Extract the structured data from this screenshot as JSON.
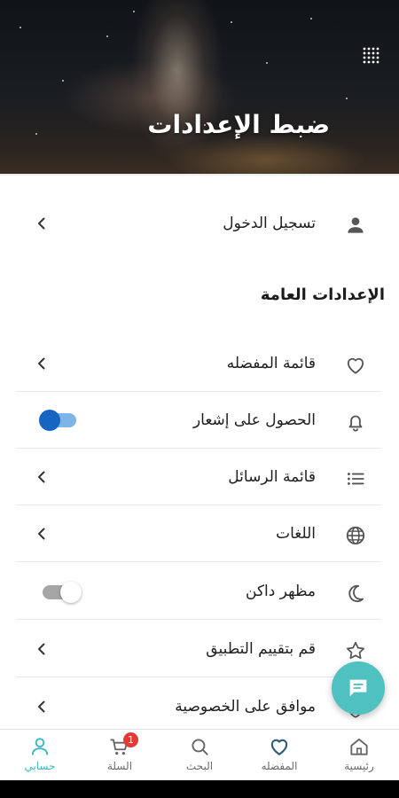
{
  "header": {
    "title": "ضبط الإعدادات",
    "grid_icon": "grid-dots-icon"
  },
  "account": {
    "login_label": "تسجيل الدخول",
    "icon": "person-icon"
  },
  "general": {
    "section_title": "الإعدادات العامة",
    "items": [
      {
        "label": "قائمة المفضله",
        "icon": "heart-icon",
        "control": "chevron"
      },
      {
        "label": "الحصول على إشعار",
        "icon": "bell-icon",
        "control": "toggle",
        "toggle_on": true
      },
      {
        "label": "قائمة الرسائل",
        "icon": "list-icon",
        "control": "chevron"
      },
      {
        "label": "اللغات",
        "icon": "globe-icon",
        "control": "chevron"
      },
      {
        "label": "مظهر داكن",
        "icon": "moon-icon",
        "control": "toggle",
        "toggle_on": false
      },
      {
        "label": "قم بتقييم التطبيق",
        "icon": "star-icon",
        "control": "chevron"
      },
      {
        "label": "موافق على الخصوصية",
        "icon": "shield-icon",
        "control": "chevron"
      }
    ]
  },
  "fab": {
    "icon": "chat-icon"
  },
  "bottom_nav": {
    "items": [
      {
        "label": "رئيسية",
        "icon": "home-icon",
        "active": false
      },
      {
        "label": "المفضله",
        "icon": "heart-icon",
        "active": false
      },
      {
        "label": "البحث",
        "icon": "search-icon",
        "active": false
      },
      {
        "label": "السلة",
        "icon": "cart-icon",
        "active": false,
        "badge": "1"
      },
      {
        "label": "حسابي",
        "icon": "account-icon",
        "active": true
      }
    ]
  },
  "colors": {
    "accent": "#3eb7c2",
    "fab": "#4fc1c1",
    "toggle_on": "#1665c0",
    "badge": "#e53935"
  }
}
